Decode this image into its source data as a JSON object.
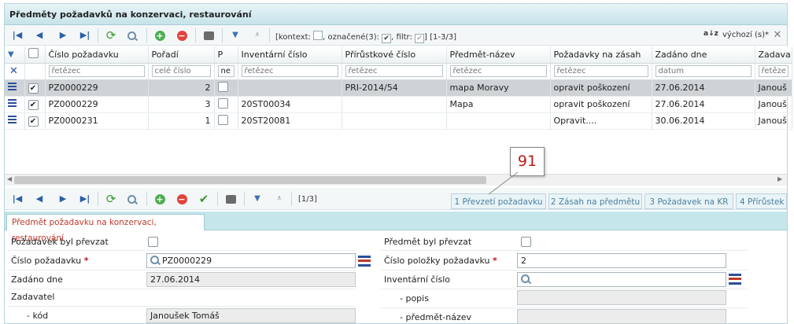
{
  "title": "Předměty požadavků na konzervaci, restaurování",
  "toolbar_top": {
    "context_label": "[kontext:",
    "marked_label": ", označené(3):",
    "filter_label": ", filtr:",
    "range": "[1-3/3]",
    "default_sort": "výchozí (s)*"
  },
  "grid": {
    "columns": [
      "Číslo požadavku",
      "Pořadí",
      "P",
      "Inventární číslo",
      "Přírůstkové číslo",
      "Předmět-název",
      "Požadavky na zásah",
      "Zadáno dne",
      "Zadava"
    ],
    "filters": [
      "řetězec",
      "celé číslo",
      "ne",
      "řetězec",
      "řetězec",
      "řetězec",
      "řetězec",
      "datum",
      "řetězec"
    ],
    "rows": [
      {
        "cislo": "PZ0000229",
        "poradi": "2",
        "inv": "",
        "prir": "PRI-2014/54",
        "nazev": "mapa Moravy",
        "pozadavky": "opravit poškození",
        "zadano": "27.06.2014",
        "zadavatel": "Janouš",
        "selected": true
      },
      {
        "cislo": "PZ0000229",
        "poradi": "3",
        "inv": "20ST00034",
        "prir": "",
        "nazev": "Mapa",
        "pozadavky": "opravit poškození",
        "zadano": "27.06.2014",
        "zadavatel": "Janouš",
        "selected": false
      },
      {
        "cislo": "PZ0000231",
        "poradi": "1",
        "inv": "20ST20081",
        "prir": "",
        "nazev": "",
        "pozadavky": "Opravit....",
        "zadano": "30.06.2014",
        "zadavatel": "Janouš",
        "selected": false
      }
    ]
  },
  "toolbar_bottom": {
    "range": "[1/3]"
  },
  "callout": "91",
  "subtabs": [
    "1 Převzetí požadavku",
    "2 Zásah na předmětu",
    "3 Požadavek na KR",
    "4 Přírůstek"
  ],
  "form": {
    "tab": "Předmět požadavku na konzervaci, restaurování",
    "left": {
      "pozadavek_prevzat": "Požadavek byl převzat",
      "cislo_pozadavku_label": "Číslo požadavku",
      "cislo_pozadavku_value": "PZ0000229",
      "zadano_label": "Zadáno dne",
      "zadano_value": "27.06.2014",
      "zadavatel_label": "Zadavatel",
      "kod_label": "- kód",
      "kod_value": "Janoušek Tomáš"
    },
    "right": {
      "predmet_prevzat": "Předmět byl převzat",
      "cislo_polozky_label": "Číslo položky požadavku",
      "cislo_polozky_value": "2",
      "inv_label": "Inventární číslo",
      "popis_label": "- popis",
      "nazev_label": "- předmět-název"
    },
    "required_mark": "*"
  }
}
